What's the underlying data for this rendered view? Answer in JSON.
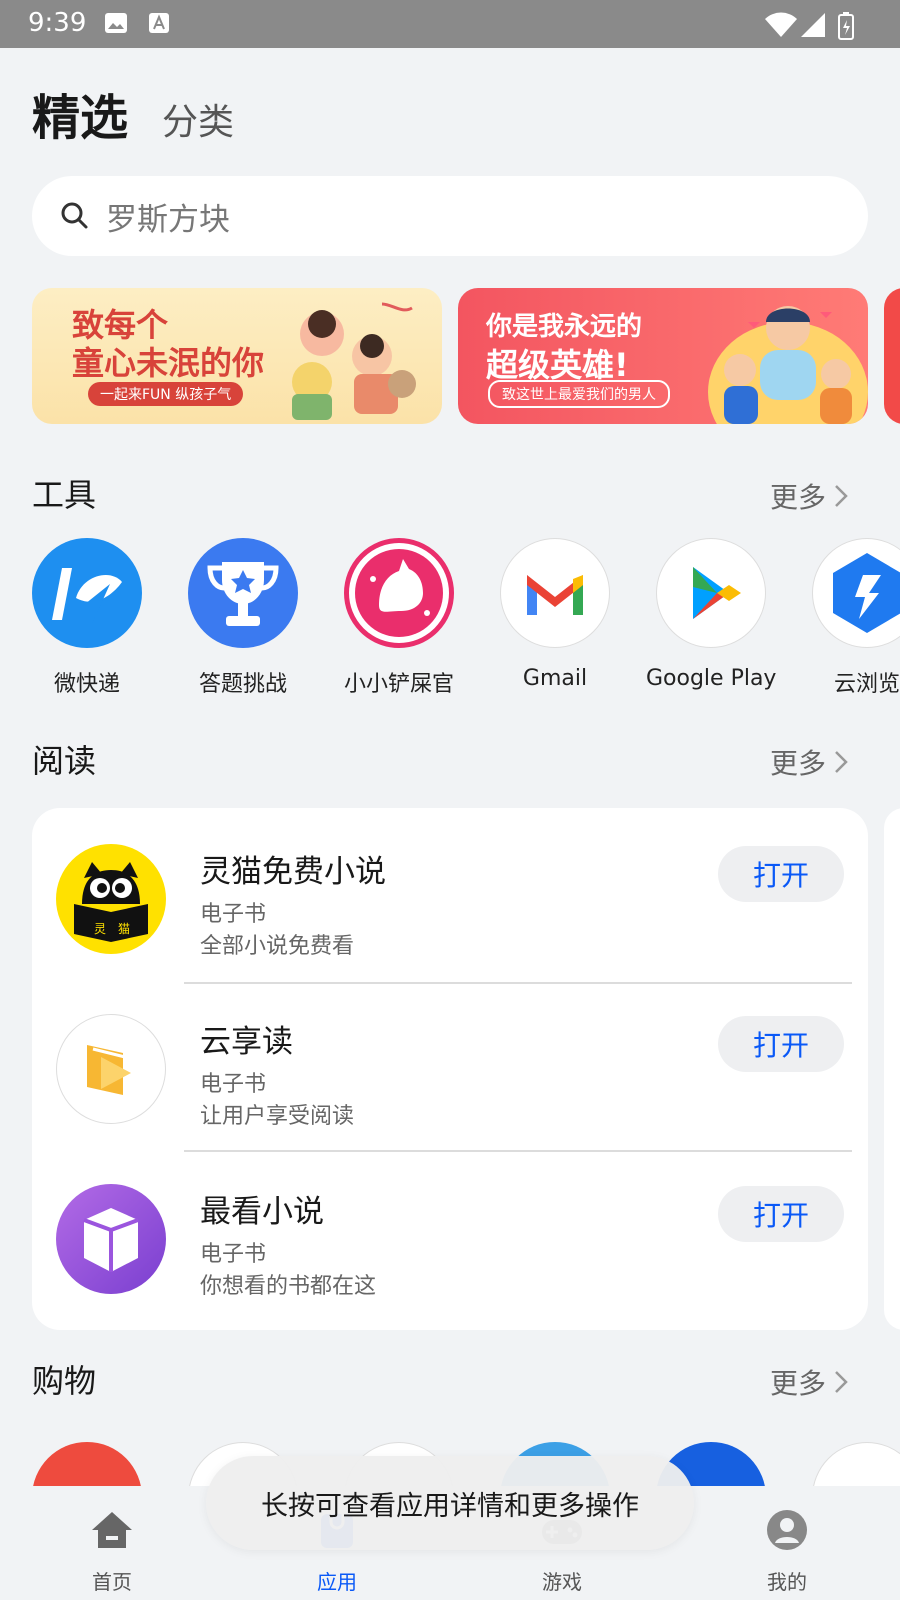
{
  "status_bar": {
    "time": "9:39"
  },
  "top_tabs": {
    "featured": "精选",
    "category": "分类"
  },
  "search": {
    "placeholder": "罗斯方块"
  },
  "banners": [
    {
      "line1": "致每个",
      "line2": "童心未泯的你",
      "sub": "一起来FUN 纵孩子气"
    },
    {
      "line1": "你是我永远的",
      "line2": "超级英雄!",
      "sub": "致这世上最爱我们的男人"
    }
  ],
  "tools": {
    "title": "工具",
    "more": "更多",
    "apps": [
      "微快递",
      "答题挑战",
      "小小铲屎官",
      "Gmail",
      "Google Play",
      "云浏览"
    ]
  },
  "reading": {
    "title": "阅读",
    "more": "更多",
    "apps": [
      {
        "name": "灵猫免费小说",
        "category": "电子书",
        "desc": "全部小说免费看",
        "button": "打开",
        "icon_text": [
          "灵",
          "猫"
        ]
      },
      {
        "name": "云享读",
        "category": "电子书",
        "desc": "让用户享受阅读",
        "button": "打开"
      },
      {
        "name": "最看小说",
        "category": "电子书",
        "desc": "你想看的书都在这",
        "button": "打开"
      }
    ]
  },
  "shopping": {
    "title": "购物",
    "more": "更多"
  },
  "bottom_nav": [
    {
      "label": "首页",
      "icon": "home-icon",
      "active": false
    },
    {
      "label": "应用",
      "icon": "apps-icon",
      "active": true
    },
    {
      "label": "游戏",
      "icon": "game-icon",
      "active": false
    },
    {
      "label": "我的",
      "icon": "profile-icon",
      "active": false
    }
  ],
  "toast": "长按可查看应用详情和更多操作",
  "colors": {
    "accent": "#0a59f7",
    "background": "#f1f3f5"
  }
}
